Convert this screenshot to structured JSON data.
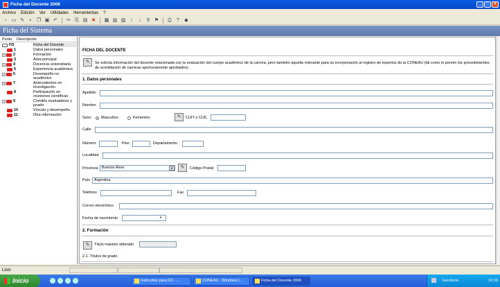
{
  "window": {
    "title": "Ficha del Docente 2006"
  },
  "menu": [
    "Archivo",
    "Edición",
    "Ver",
    "Utilidades",
    "Herramientas",
    "?"
  ],
  "header": {
    "title": "Ficha del Sistema"
  },
  "tree": {
    "col_punto": "Punto",
    "col_desc": "Descripción",
    "items": [
      {
        "num": "FD",
        "label": "Ficha del Docente"
      },
      {
        "num": "1",
        "label": "Datos personales"
      },
      {
        "num": "2",
        "label": "Formación"
      },
      {
        "num": "3",
        "label": "Área principal"
      },
      {
        "num": "4",
        "label": "Docencia universitaria"
      },
      {
        "num": "5",
        "label": "Experiencia académica"
      },
      {
        "num": "6",
        "label": "Desempeño no académico"
      },
      {
        "num": "7",
        "label": "Antecedentes en investigación"
      },
      {
        "num": "8",
        "label": "Participación en reuniones científicas"
      },
      {
        "num": "9",
        "label": "Comités evaluadores y jurado"
      },
      {
        "num": "10",
        "label": "Vínculo y desempeño"
      },
      {
        "num": "11",
        "label": "Otra información"
      }
    ]
  },
  "form": {
    "title": "FICHA DEL DOCENTE",
    "info": "Se solicita información del docente relacionada con la evaluación del cuerpo académico de la carrera, pero también aquella relevante para su incorporación al registro de expertos de la CONEAU (tal como lo prevén los procedimientos de acreditación de carreras oportunamente aprobados).",
    "section1": "1. Datos personales",
    "apellido": "Apellido",
    "nombre": "Nombre",
    "sexo": "Sexo",
    "masculino": "Masculino",
    "femenino": "Femenino",
    "cuit": "CUIT o CUIL",
    "calle": "Calle",
    "numero": "Número",
    "piso": "Piso",
    "departamento": "Departamento",
    "localidad": "Localidad",
    "provincia": "Provincia",
    "provincia_value": "Buenos Aires",
    "codigo_postal": "Código Postal",
    "pais": "País",
    "pais_value": "Argentina",
    "telefono": "Teléfono",
    "fax": "Fax",
    "correo": "Correo electrónico",
    "fecha_nac": "Fecha de nacimiento",
    "section2": "2. Formación",
    "titulo_max": "Título máximo obtenido",
    "titulos_grado": "2.1. Títulos de grado."
  },
  "status": {
    "text": "Listo"
  },
  "taskbar": {
    "start": "Inicio",
    "tasks": [
      "Instructivo para FD - ...",
      "CONEAU - Windows I...",
      "Ficha del Docente 2006"
    ],
    "tray_text": "Escritorio",
    "clock": "10:16"
  }
}
